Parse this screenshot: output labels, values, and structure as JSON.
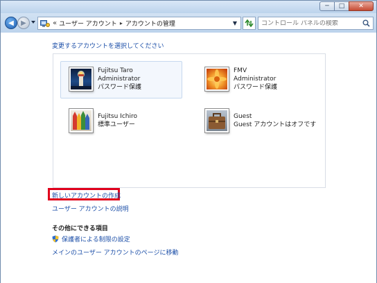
{
  "window": {
    "minimize": "─",
    "maximize": "□",
    "close": "✕"
  },
  "nav": {
    "back_icon": "◀",
    "forward_icon": "▶"
  },
  "address": {
    "overflow": "«",
    "separator": "▸",
    "crumbs": [
      "ユーザー アカウント",
      "アカウントの管理"
    ]
  },
  "search": {
    "placeholder": "コントロール パネルの検索"
  },
  "main": {
    "heading": "変更するアカウントを選択してください",
    "accounts": [
      {
        "name": "Fujitsu Taro",
        "type": "Administrator",
        "status": "パスワード保護"
      },
      {
        "name": "FMV",
        "type": "Administrator",
        "status": "パスワード保護"
      },
      {
        "name": "Fujitsu Ichiro",
        "type": "標準ユーザー",
        "status": ""
      },
      {
        "name": "Guest",
        "type": "Guest アカウントはオフです",
        "status": ""
      }
    ],
    "create_account": "新しいアカウントの作成",
    "explain_accounts": "ユーザー アカウントの説明",
    "other_heading": "その他にできる項目",
    "parental_controls": "保護者による制限の設定",
    "main_page": "メインのユーザー アカウントのページに移動"
  },
  "colors": {
    "link": "#1c4fa8",
    "highlight_border": "#e0001b"
  }
}
